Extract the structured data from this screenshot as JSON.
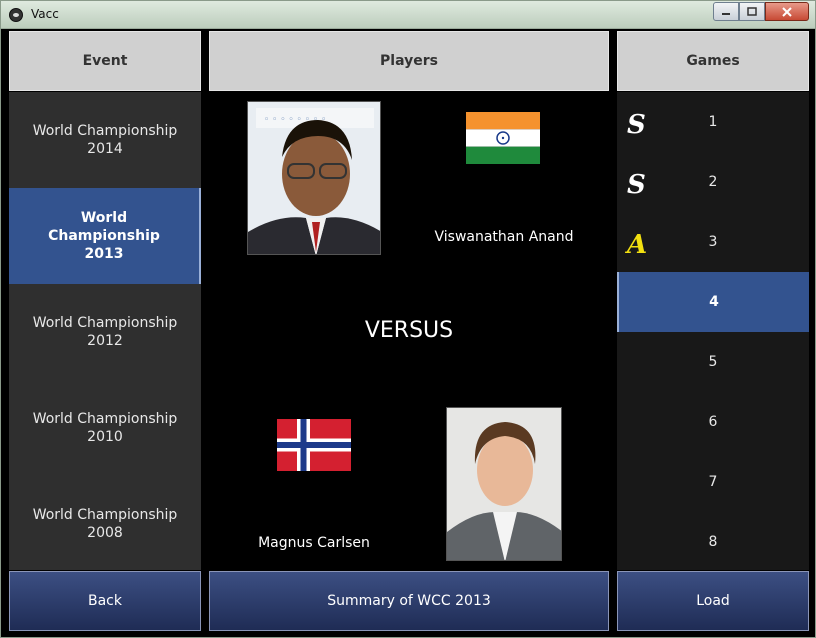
{
  "window": {
    "title": "Vacc"
  },
  "columns": {
    "event": "Event",
    "players": "Players",
    "games": "Games"
  },
  "events": [
    {
      "label": "World Championship 2014",
      "selected": false
    },
    {
      "label": "World Championship 2013",
      "selected": true
    },
    {
      "label": "World Championship 2012",
      "selected": false
    },
    {
      "label": "World Championship 2010",
      "selected": false
    },
    {
      "label": "World Championship 2008",
      "selected": false
    }
  ],
  "players": {
    "top": {
      "name": "Viswanathan Anand",
      "flag": "india-flag"
    },
    "bottom": {
      "name": "Magnus Carlsen",
      "flag": "norway-flag"
    },
    "versus": "VERSUS"
  },
  "games": [
    {
      "number": "1",
      "result": "S",
      "result_color": "#ffffff"
    },
    {
      "number": "2",
      "result": "S",
      "result_color": "#ffffff"
    },
    {
      "number": "3",
      "result": "A",
      "result_color": "#f2e010"
    },
    {
      "number": "4",
      "result": "",
      "selected": true
    },
    {
      "number": "5",
      "result": ""
    },
    {
      "number": "6",
      "result": ""
    },
    {
      "number": "7",
      "result": ""
    },
    {
      "number": "8",
      "result": ""
    }
  ],
  "buttons": {
    "back": "Back",
    "summary": "Summary of WCC 2013",
    "load": "Load"
  },
  "colors": {
    "selected": "#33538f",
    "header": "#d0d0d0",
    "button": "#2a3a6b"
  }
}
